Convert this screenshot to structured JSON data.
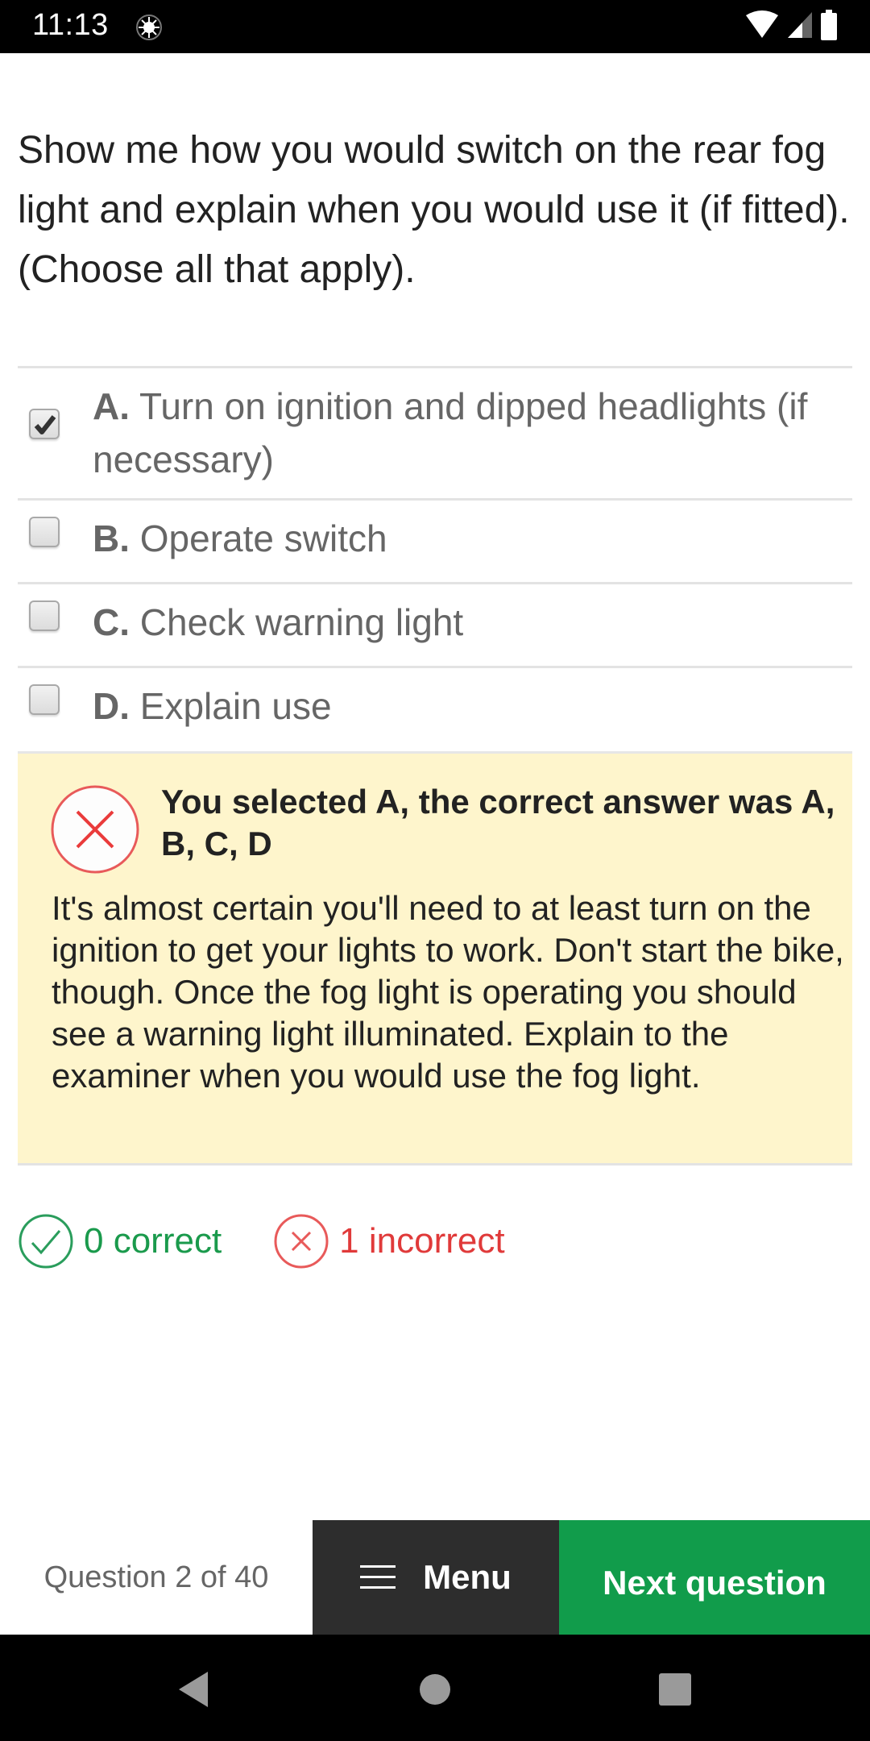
{
  "status_bar": {
    "time": "11:13",
    "icons": [
      "notification-icon",
      "wifi-icon",
      "cell-signal-icon",
      "battery-icon"
    ]
  },
  "question": {
    "text": "Show me how you would switch on the rear fog light and explain when you would use it (if fitted). (Choose all that apply)."
  },
  "options": [
    {
      "letter": "A.",
      "text": "Turn on ignition and dipped headlights (if necessary)",
      "checked": true
    },
    {
      "letter": "B.",
      "text": "Operate switch",
      "checked": false
    },
    {
      "letter": "C.",
      "text": "Check warning light",
      "checked": false
    },
    {
      "letter": "D.",
      "text": "Explain use",
      "checked": false
    }
  ],
  "feedback": {
    "icon": "incorrect-x-icon",
    "title": "You selected A, the correct answer was A, B, C, D",
    "body": "It's almost certain you'll need to at least turn on the ignition to get your lights to work. Don't start the bike, though. Once the fog light is operating you should see a warning light illuminated. Explain to the examiner when you would use the fog light.",
    "background_color": "#fef5cc"
  },
  "score": {
    "correct_label": "0 correct",
    "incorrect_label": "1 incorrect",
    "correct_color": "#1a9a4c",
    "incorrect_color": "#e03a3a"
  },
  "bottom_bar": {
    "question_counter": "Question 2 of 40",
    "menu_label": "Menu",
    "next_label": "Next question",
    "next_color": "#119c4b",
    "menu_color": "#2d2d2d"
  },
  "nav_bar": {
    "buttons": [
      "back",
      "home",
      "recents"
    ]
  }
}
